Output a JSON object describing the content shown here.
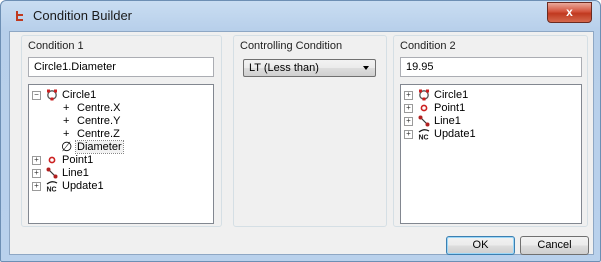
{
  "window": {
    "title": "Condition Builder",
    "close_label": "x"
  },
  "condition1": {
    "label": "Condition 1",
    "value": "Circle1.Diameter",
    "tree": {
      "circle": "Circle1",
      "children": [
        "Centre.X",
        "Centre.Y",
        "Centre.Z",
        "Diameter"
      ],
      "point": "Point1",
      "line": "Line1",
      "update": "Update1"
    }
  },
  "controlling": {
    "label": "Controlling Condition",
    "selected": "LT (Less than)"
  },
  "condition2": {
    "label": "Condition 2",
    "value": "19.95",
    "tree": {
      "circle": "Circle1",
      "point": "Point1",
      "line": "Line1",
      "update": "Update1"
    }
  },
  "buttons": {
    "ok": "OK",
    "cancel": "Cancel"
  },
  "glyphs": {
    "collapse": "−",
    "expand": "+",
    "plus": "+",
    "diameter": "∅",
    "nc": "NC"
  },
  "colors": {
    "accent": "#c0391f",
    "point": "#cc2020",
    "line_icon": "#b02020"
  }
}
